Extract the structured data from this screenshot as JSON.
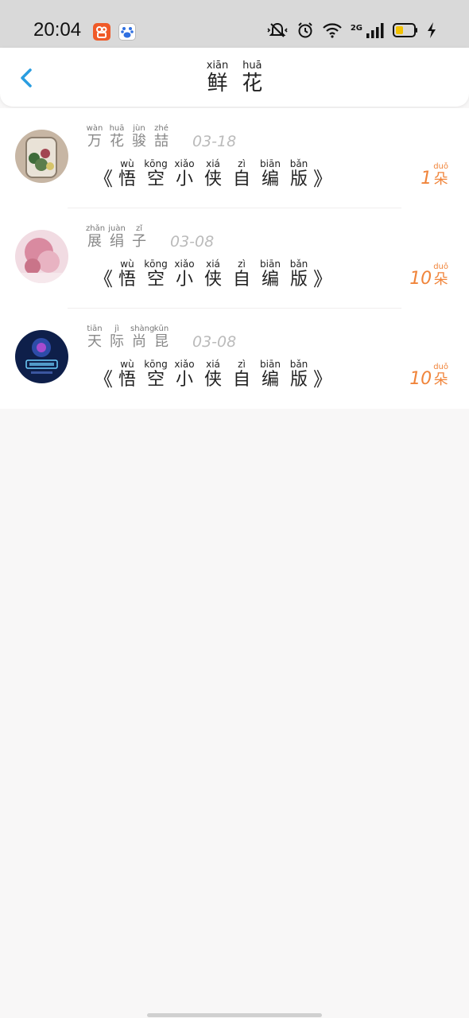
{
  "status": {
    "time": "20:04",
    "network": "2G",
    "icons": [
      "kuaishou-app-icon",
      "baidu-app-icon",
      "mute-icon",
      "alarm-icon",
      "wifi-icon",
      "signal-icon",
      "battery-icon",
      "charging-icon"
    ]
  },
  "header": {
    "title": [
      {
        "py": "xiān",
        "hz": "鲜"
      },
      {
        "py": "huā",
        "hz": "花"
      }
    ],
    "back_icon": "chevron-left-icon",
    "accent": "#2a9de0"
  },
  "rows": [
    {
      "name": [
        {
          "py": "wàn",
          "hz": "万"
        },
        {
          "py": "huā",
          "hz": "花"
        },
        {
          "py": "jùn",
          "hz": "骏"
        },
        {
          "py": "zhé",
          "hz": "喆"
        }
      ],
      "date": "03-18",
      "gift": [
        {
          "py": "wù",
          "hz": "悟"
        },
        {
          "py": "kōng",
          "hz": "空"
        },
        {
          "py": "xiǎo",
          "hz": "小"
        },
        {
          "py": "xiá",
          "hz": "侠"
        },
        {
          "py": "zì",
          "hz": "自"
        },
        {
          "py": "biān",
          "hz": "编"
        },
        {
          "py": "bǎn",
          "hz": "版"
        }
      ],
      "bracket_open": "《",
      "bracket_close": "》",
      "count": "1",
      "unit_py": "duǒ",
      "unit_hz": "朵",
      "avatar": "avatar-photo-jar"
    },
    {
      "name": [
        {
          "py": "zhǎn",
          "hz": "展"
        },
        {
          "py": "juàn",
          "hz": "绢"
        },
        {
          "py": "zǐ",
          "hz": "子"
        }
      ],
      "date": "03-08",
      "gift": [
        {
          "py": "wù",
          "hz": "悟"
        },
        {
          "py": "kōng",
          "hz": "空"
        },
        {
          "py": "xiǎo",
          "hz": "小"
        },
        {
          "py": "xiá",
          "hz": "侠"
        },
        {
          "py": "zì",
          "hz": "自"
        },
        {
          "py": "biān",
          "hz": "编"
        },
        {
          "py": "bǎn",
          "hz": "版"
        }
      ],
      "bracket_open": "《",
      "bracket_close": "》",
      "count": "10",
      "unit_py": "duǒ",
      "unit_hz": "朵",
      "avatar": "avatar-photo-pink"
    },
    {
      "name": [
        {
          "py": "tiān",
          "hz": "天"
        },
        {
          "py": "jì",
          "hz": "际"
        },
        {
          "py": "shàng",
          "hz": "尚"
        },
        {
          "py": "kūn",
          "hz": "昆"
        }
      ],
      "date": "03-08",
      "gift": [
        {
          "py": "wù",
          "hz": "悟"
        },
        {
          "py": "kōng",
          "hz": "空"
        },
        {
          "py": "xiǎo",
          "hz": "小"
        },
        {
          "py": "xiá",
          "hz": "侠"
        },
        {
          "py": "zì",
          "hz": "自"
        },
        {
          "py": "biān",
          "hz": "编"
        },
        {
          "py": "bǎn",
          "hz": "版"
        }
      ],
      "bracket_open": "《",
      "bracket_close": "》",
      "count": "10",
      "unit_py": "duǒ",
      "unit_hz": "朵",
      "avatar": "avatar-logo-blue"
    }
  ],
  "colors": {
    "count": "#f0843a",
    "status_bar": "#d9d9d9",
    "background": "#f8f7f7"
  }
}
